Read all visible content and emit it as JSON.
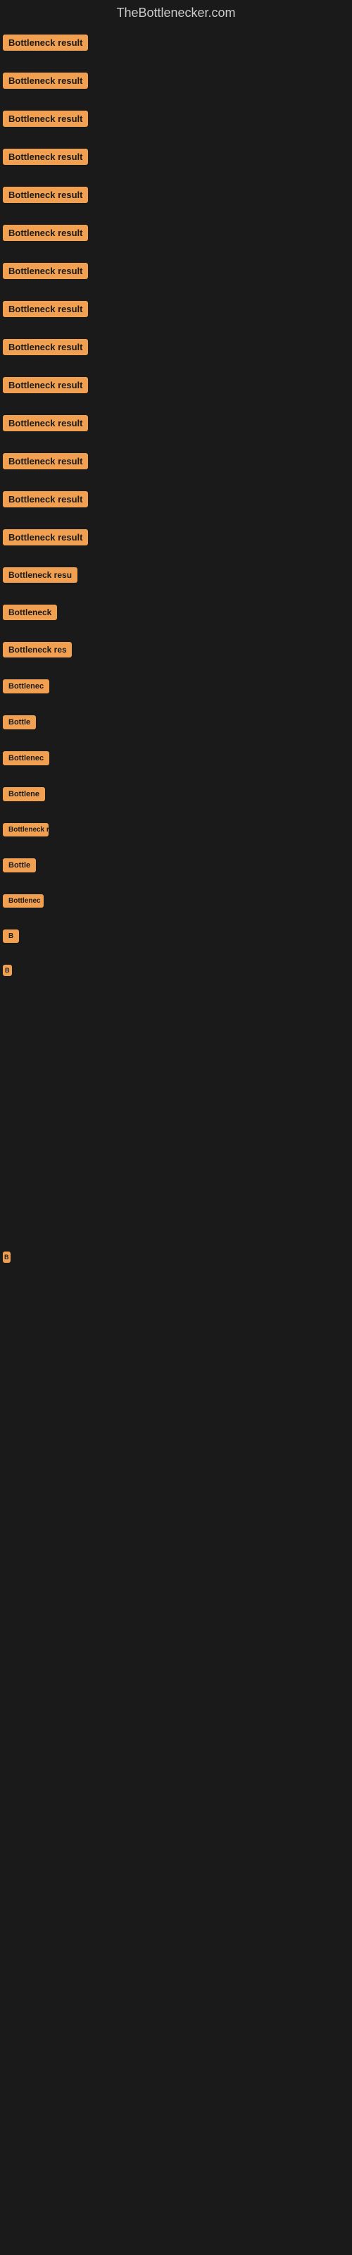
{
  "site": {
    "title": "TheBottlenecker.com"
  },
  "items": [
    {
      "id": 0,
      "label": "Bottleneck result"
    },
    {
      "id": 1,
      "label": "Bottleneck result"
    },
    {
      "id": 2,
      "label": "Bottleneck result"
    },
    {
      "id": 3,
      "label": "Bottleneck result"
    },
    {
      "id": 4,
      "label": "Bottleneck result"
    },
    {
      "id": 5,
      "label": "Bottleneck result"
    },
    {
      "id": 6,
      "label": "Bottleneck result"
    },
    {
      "id": 7,
      "label": "Bottleneck result"
    },
    {
      "id": 8,
      "label": "Bottleneck result"
    },
    {
      "id": 9,
      "label": "Bottleneck result"
    },
    {
      "id": 10,
      "label": "Bottleneck result"
    },
    {
      "id": 11,
      "label": "Bottleneck result"
    },
    {
      "id": 12,
      "label": "Bottleneck result"
    },
    {
      "id": 13,
      "label": "Bottleneck result"
    },
    {
      "id": 14,
      "label": "Bottleneck resu"
    },
    {
      "id": 15,
      "label": "Bottleneck"
    },
    {
      "id": 16,
      "label": "Bottleneck res"
    },
    {
      "id": 17,
      "label": "Bottlenec"
    },
    {
      "id": 18,
      "label": "Bottle"
    },
    {
      "id": 19,
      "label": "Bottlenec"
    },
    {
      "id": 20,
      "label": "Bottlene"
    },
    {
      "id": 21,
      "label": "Bottleneck r"
    },
    {
      "id": 22,
      "label": "Bottle"
    },
    {
      "id": 23,
      "label": "Bottlenec"
    },
    {
      "id": 24,
      "label": "B"
    },
    {
      "id": 25,
      "label": ""
    },
    {
      "id": 26,
      "label": ""
    },
    {
      "id": 27,
      "label": ""
    },
    {
      "id": 28,
      "label": "B"
    }
  ],
  "colors": {
    "background": "#1a1a1a",
    "badge_bg": "#f0a050",
    "badge_text": "#1a1a1a",
    "title_text": "#cccccc"
  }
}
